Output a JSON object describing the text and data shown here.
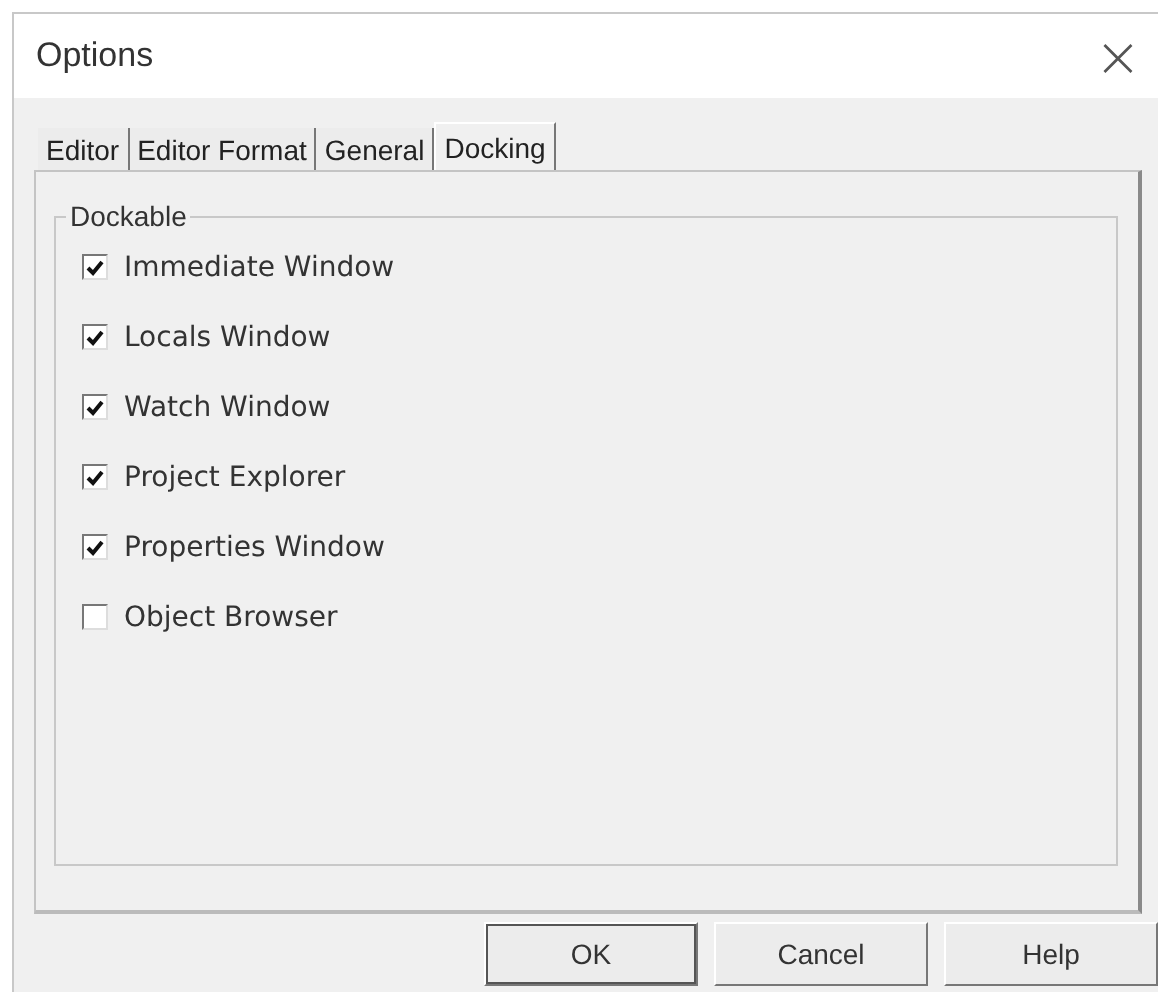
{
  "window": {
    "title": "Options",
    "close": "×"
  },
  "tabs": [
    {
      "label": "Editor",
      "selected": false
    },
    {
      "label": "Editor Format",
      "selected": false
    },
    {
      "label": "General",
      "selected": false
    },
    {
      "label": "Docking",
      "selected": true
    }
  ],
  "group": {
    "title": "Dockable",
    "items": [
      {
        "label": "Immediate Window",
        "checked": true
      },
      {
        "label": "Locals Window",
        "checked": true
      },
      {
        "label": "Watch Window",
        "checked": true
      },
      {
        "label": "Project Explorer",
        "checked": true
      },
      {
        "label": "Properties Window",
        "checked": true
      },
      {
        "label": "Object Browser",
        "checked": false
      }
    ]
  },
  "buttons": [
    {
      "label": "OK",
      "default": true
    },
    {
      "label": "Cancel",
      "default": false
    },
    {
      "label": "Help",
      "default": false
    }
  ]
}
